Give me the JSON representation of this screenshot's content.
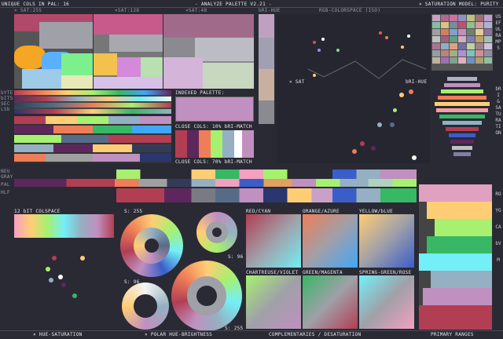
{
  "header": {
    "unique_cols": "UNIQUE COLS IN PAL: 16",
    "title": "- ANALYZE PALETTE V2.21 -",
    "sat_model": "× SATURATION MODEL: PURITY"
  },
  "top_axis": {
    "a": "× SAT:255",
    "b": "×SAT:128",
    "c": "×SAT:48",
    "d": "bRI-HUE",
    "e": "RGB-COLORSPACE (ISO)"
  },
  "left_labels": {
    "byte": "bYTE",
    "bits": "bITS",
    "sec": "SEC",
    "lsb": "LSb",
    "neu": "NEU",
    "gray": "GRAY",
    "pal": "PAL",
    "hlf": "HLF"
  },
  "indexed": {
    "title": "INDEXED PALETTE:",
    "close10": "CLOSE COLS: 10% bRI-MATCH",
    "close70": "CLOSE COLS: 70% bRI-MATCH"
  },
  "rgb": {
    "sat": "× SAT",
    "brihue": "bRI-HUE"
  },
  "colspace12": "12 bIT COLSPACE",
  "s_labels": {
    "s255a": "S: 255",
    "s96a": "S: 96",
    "s96b": "S: 96",
    "s255b": "S: 255"
  },
  "pairs": {
    "red": "RED/CYAN",
    "orange": "ORANGE/AZURE",
    "yellow": "YELLOW/bLUE",
    "chart": "CHARTREUSE/VIOLET",
    "green": "GREEN/MAGENTA",
    "spring": "SPRING-GREEN/ROSE"
  },
  "right_vertical": {
    "useful": "USEFUL RAMPS",
    "bri": "bRI & SATURATION",
    "hue": "ROYGCAbVM"
  },
  "footer": {
    "hs": "× HUE-SATURATION",
    "polar": "× POLAR HUE-BRIGHTNESS",
    "comp": "COMPLEMENTARIES / DESATURATION",
    "primary": "PRIMARY RANGES"
  },
  "palette": [
    "#1a1c2c",
    "#5d275d",
    "#b13e53",
    "#ef7d57",
    "#ffcd75",
    "#a7f070",
    "#38b764",
    "#257179",
    "#29366f",
    "#3b5dc9",
    "#41a6f6",
    "#73eff7",
    "#f4f4f4",
    "#94b0c2",
    "#566c86",
    "#333c57"
  ],
  "colors": {
    "bg": "#2a2a35",
    "accent": "#ffffff"
  }
}
